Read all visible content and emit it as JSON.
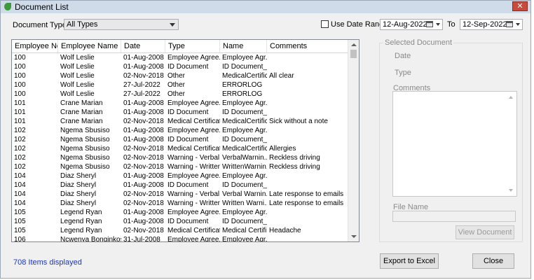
{
  "window": {
    "title": "Document List",
    "close_label": "✕"
  },
  "filters": {
    "document_type_label": "Document Type",
    "document_type_value": "All Types",
    "use_date_range_label": "Use Date Range",
    "use_date_range_checked": false,
    "date_from": "12-Aug-2022",
    "to_label": "To",
    "date_to": "12-Sep-2022"
  },
  "grid": {
    "columns": [
      "Employee No",
      "Employee Name",
      "Date",
      "Type",
      "Name",
      "Comments"
    ],
    "rows": [
      [
        "100",
        "Wolf Leslie",
        "01-Aug-2008",
        "Employee Agree...",
        "Employee Agr...",
        ""
      ],
      [
        "100",
        "Wolf Leslie",
        "01-Aug-2008",
        "ID Document",
        "ID Document_...",
        ""
      ],
      [
        "100",
        "Wolf Leslie",
        "02-Nov-2018",
        "Other",
        "MedicalCertific...",
        "All clear"
      ],
      [
        "100",
        "Wolf Leslie",
        "27-Jul-2022",
        "Other",
        "ERRORLOG",
        ""
      ],
      [
        "100",
        "Wolf Leslie",
        "27-Jul-2022",
        "Other",
        "ERRORLOG",
        ""
      ],
      [
        "101",
        "Crane Marian",
        "01-Aug-2008",
        "Employee Agree...",
        "Employee Agr...",
        ""
      ],
      [
        "101",
        "Crane Marian",
        "01-Aug-2008",
        "ID Document",
        "ID Document_...",
        ""
      ],
      [
        "101",
        "Crane Marian",
        "02-Nov-2018",
        "Medical Certificate",
        "MedicalCertific...",
        "Sick without a note"
      ],
      [
        "102",
        "Ngema Sbusiso",
        "01-Aug-2008",
        "Employee Agree...",
        "Employee Agr...",
        ""
      ],
      [
        "102",
        "Ngema Sbusiso",
        "01-Aug-2008",
        "ID Document",
        "ID Document_...",
        ""
      ],
      [
        "102",
        "Ngema Sbusiso",
        "02-Nov-2018",
        "Medical Certificate",
        "MedicalCertific...",
        "Allergies"
      ],
      [
        "102",
        "Ngema Sbusiso",
        "02-Nov-2018",
        "Warning - Verbal",
        "VerbalWarnin...",
        "Reckless driving"
      ],
      [
        "102",
        "Ngema Sbusiso",
        "02-Nov-2018",
        "Warning - Written",
        "WrittenWarnin...",
        "Reckless driving"
      ],
      [
        "104",
        "Diaz Sheryl",
        "01-Aug-2008",
        "Employee Agree...",
        "Employee Agr...",
        ""
      ],
      [
        "104",
        "Diaz Sheryl",
        "01-Aug-2008",
        "ID Document",
        "ID Document_...",
        ""
      ],
      [
        "104",
        "Diaz Sheryl",
        "02-Nov-2018",
        "Warning - Verbal",
        "Verbal Warnin...",
        "Late response to emails"
      ],
      [
        "104",
        "Diaz Sheryl",
        "02-Nov-2018",
        "Warning - Written",
        "Written Warni...",
        "Late response to emails"
      ],
      [
        "105",
        "Legend Ryan",
        "01-Aug-2008",
        "Employee Agree...",
        "Employee Agr...",
        ""
      ],
      [
        "105",
        "Legend Ryan",
        "01-Aug-2008",
        "ID Document",
        "ID Document_...",
        ""
      ],
      [
        "105",
        "Legend Ryan",
        "02-Nov-2018",
        "Medical Certificate",
        "Medical Certifi...",
        "Headache"
      ],
      [
        "106",
        "Ncwenya Bonginkosi",
        "31-Jul-2008",
        "Employee Agree...",
        "Employee Agr...",
        ""
      ]
    ]
  },
  "selected_document": {
    "title": "Selected Document",
    "date_label": "Date",
    "type_label": "Type",
    "comments_label": "Comments",
    "file_name_label": "File Name",
    "view_button": "View Document"
  },
  "footer": {
    "status": "708 Items displayed",
    "export_button": "Export to Excel",
    "close_button": "Close"
  }
}
